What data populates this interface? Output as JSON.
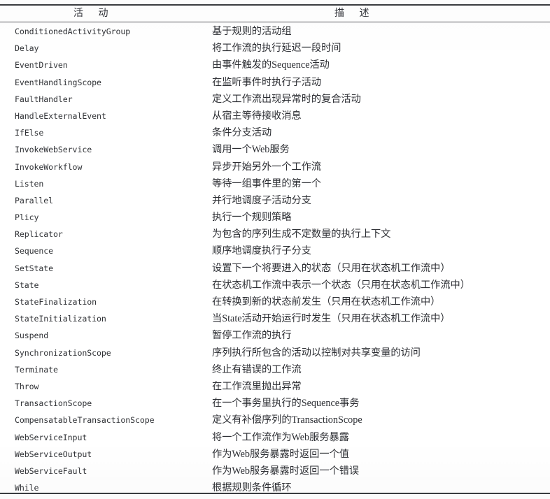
{
  "page": {
    "folio": "",
    "background_color": "#ffffff",
    "rule_color": "#3a3c40"
  },
  "table": {
    "headers": {
      "activity": "活    动",
      "description": "描    述"
    },
    "columns": [
      "活    动",
      "描    述"
    ],
    "rows": [
      {
        "activity": "ConditionedActivityGroup",
        "description": "基于规则的活动组"
      },
      {
        "activity": "Delay",
        "description": "将工作流的执行延迟一段时间"
      },
      {
        "activity": "EventDriven",
        "description": "由事件触发的Sequence活动"
      },
      {
        "activity": "EventHandlingScope",
        "description": "在监听事件时执行子活动"
      },
      {
        "activity": "FaultHandler",
        "description": "定义工作流出现异常时的复合活动"
      },
      {
        "activity": "HandleExternalEvent",
        "description": "从宿主等待接收消息"
      },
      {
        "activity": "IfElse",
        "description": "条件分支活动"
      },
      {
        "activity": "InvokeWebService",
        "description": "调用一个Web服务"
      },
      {
        "activity": "InvokeWorkflow",
        "description": "异步开始另外一个工作流"
      },
      {
        "activity": "Listen",
        "description": "等待一组事件里的第一个"
      },
      {
        "activity": "Parallel",
        "description": "并行地调度子活动分支"
      },
      {
        "activity": "Plicy",
        "description": "执行一个规则策略"
      },
      {
        "activity": "Replicator",
        "description": "为包含的序列生成不定数量的执行上下文"
      },
      {
        "activity": "Sequence",
        "description": "顺序地调度执行子分支"
      },
      {
        "activity": "SetState",
        "description": "设置下一个将要进入的状态（只用在状态机工作流中）"
      },
      {
        "activity": "State",
        "description": "在状态机工作流中表示一个状态（只用在状态机工作流中）"
      },
      {
        "activity": "StateFinalization",
        "description": "在转换到新的状态前发生（只用在状态机工作流中）"
      },
      {
        "activity": "StateInitialization",
        "description": "当State活动开始运行时发生（只用在状态机工作流中）"
      },
      {
        "activity": "Suspend",
        "description": "暂停工作流的执行"
      },
      {
        "activity": "SynchronizationScope",
        "description": "序列执行所包含的活动以控制对共享变量的访问"
      },
      {
        "activity": "Terminate",
        "description": "终止有错误的工作流"
      },
      {
        "activity": "Throw",
        "description": "在工作流里抛出异常"
      },
      {
        "activity": "TransactionScope",
        "description": "在一个事务里执行的Sequence事务"
      },
      {
        "activity": "CompensatableTransactionScope",
        "description": "定义有补偿序列的TransactionScope"
      },
      {
        "activity": "WebServiceInput",
        "description": "将一个工作流作为Web服务暴露"
      },
      {
        "activity": "WebServiceOutput",
        "description": "作为Web服务暴露时返回一个值"
      },
      {
        "activity": "WebServiceFault",
        "description": "作为Web服务暴露时返回一个错误"
      },
      {
        "activity": "While",
        "description": "根据规则条件循环"
      }
    ]
  }
}
